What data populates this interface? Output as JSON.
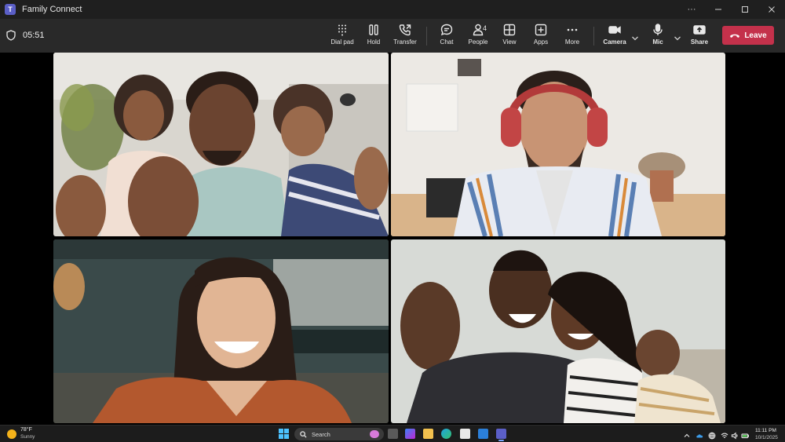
{
  "window": {
    "title": "Family Connect",
    "controls": [
      "more-options",
      "minimize",
      "maximize",
      "close"
    ],
    "more_glyph": "···"
  },
  "call": {
    "timer": "05:51",
    "toolbar": {
      "dial_pad": "Dial pad",
      "hold": "Hold",
      "transfer": "Transfer",
      "chat": "Chat",
      "people": "People",
      "people_count": "4",
      "view": "View",
      "apps": "Apps",
      "more": "More",
      "camera": "Camera",
      "mic": "Mic",
      "share": "Share",
      "leave": "Leave"
    },
    "colors": {
      "leave": "#c4314b",
      "toolbar_bg": "#292929",
      "accent": "#5b5fc7"
    },
    "participants": [
      {
        "tile": "top-left",
        "scene": "family-waving"
      },
      {
        "tile": "top-right",
        "scene": "man-with-headphones"
      },
      {
        "tile": "bottom-left",
        "scene": "woman-smiling"
      },
      {
        "tile": "bottom-right",
        "scene": "family-with-baby"
      }
    ]
  },
  "taskbar": {
    "weather_temp": "78°F",
    "weather_desc": "Sunny",
    "search_placeholder": "Search",
    "clock_time": "11:11 PM",
    "clock_date": "10/1/2025",
    "pinned_apps": [
      "task-view",
      "copilot",
      "file-explorer",
      "edge",
      "calendar",
      "store",
      "teams"
    ]
  }
}
